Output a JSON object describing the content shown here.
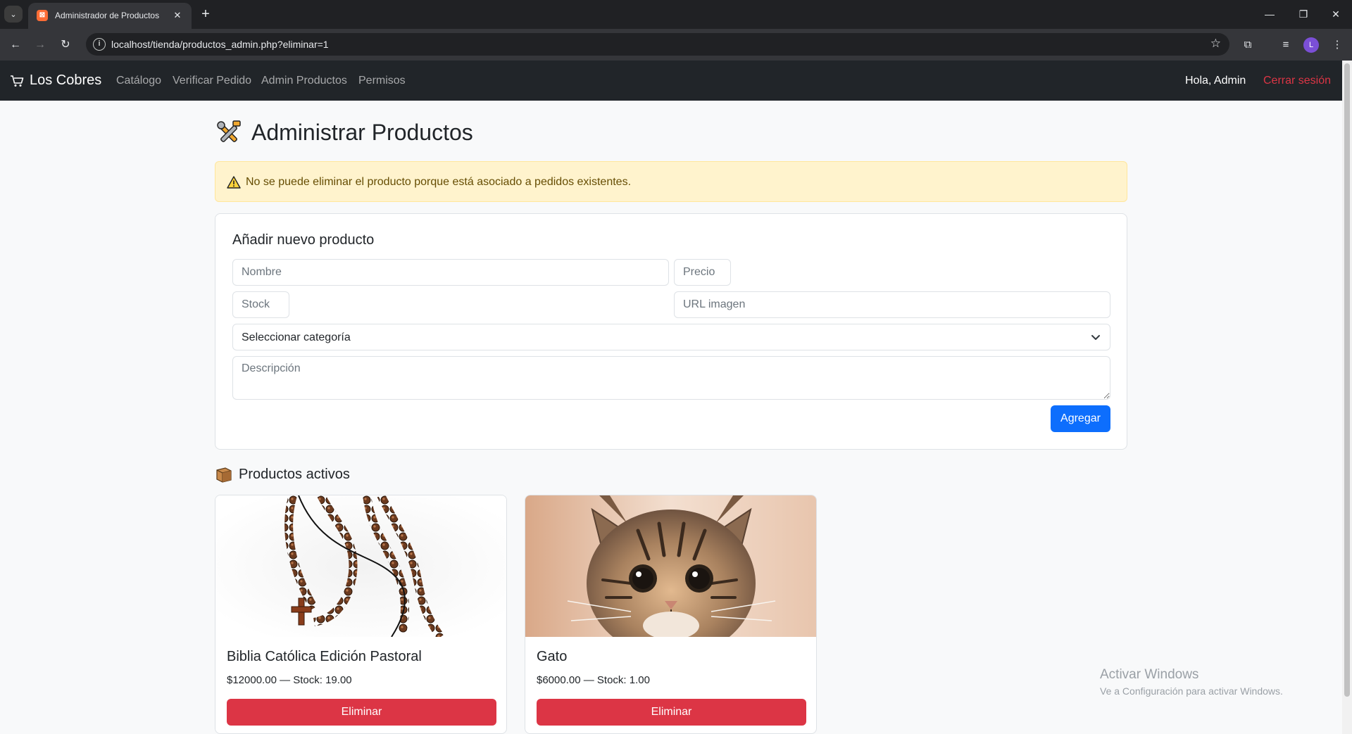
{
  "browser": {
    "tab_title": "Administrador de Productos",
    "url": "localhost/tienda/productos_admin.php?eliminar=1",
    "profile_initial": "L"
  },
  "navbar": {
    "brand": "Los Cobres",
    "links": [
      "Catálogo",
      "Verificar Pedido",
      "Admin Productos",
      "Permisos"
    ],
    "greeting": "Hola, Admin",
    "logout": "Cerrar sesión"
  },
  "page": {
    "title": "Administrar Productos",
    "alert": "No se puede eliminar el producto porque está asociado a pedidos existentes."
  },
  "form": {
    "title": "Añadir nuevo producto",
    "name_placeholder": "Nombre",
    "price_placeholder": "Precio",
    "stock_placeholder": "Stock",
    "image_placeholder": "URL imagen",
    "category_selected": "Seleccionar categoría",
    "description_placeholder": "Descripción",
    "submit_label": "Agregar"
  },
  "products_section": {
    "title": "Productos activos",
    "items": [
      {
        "name": "Biblia Católica Edición Pastoral",
        "meta": "$12000.00 — Stock: 19.00",
        "delete_label": "Eliminar",
        "image": "rosary-image"
      },
      {
        "name": "Gato",
        "meta": "$6000.00 — Stock: 1.00",
        "delete_label": "Eliminar",
        "image": "cat-image"
      }
    ]
  },
  "watermark": {
    "title": "Activar Windows",
    "subtitle": "Ve a Configuración para activar Windows."
  },
  "colors": {
    "navbar_bg": "#212529",
    "primary": "#0d6efd",
    "danger": "#dc3545",
    "alert_bg": "#fff3cd",
    "page_bg": "#f8f9fa"
  }
}
